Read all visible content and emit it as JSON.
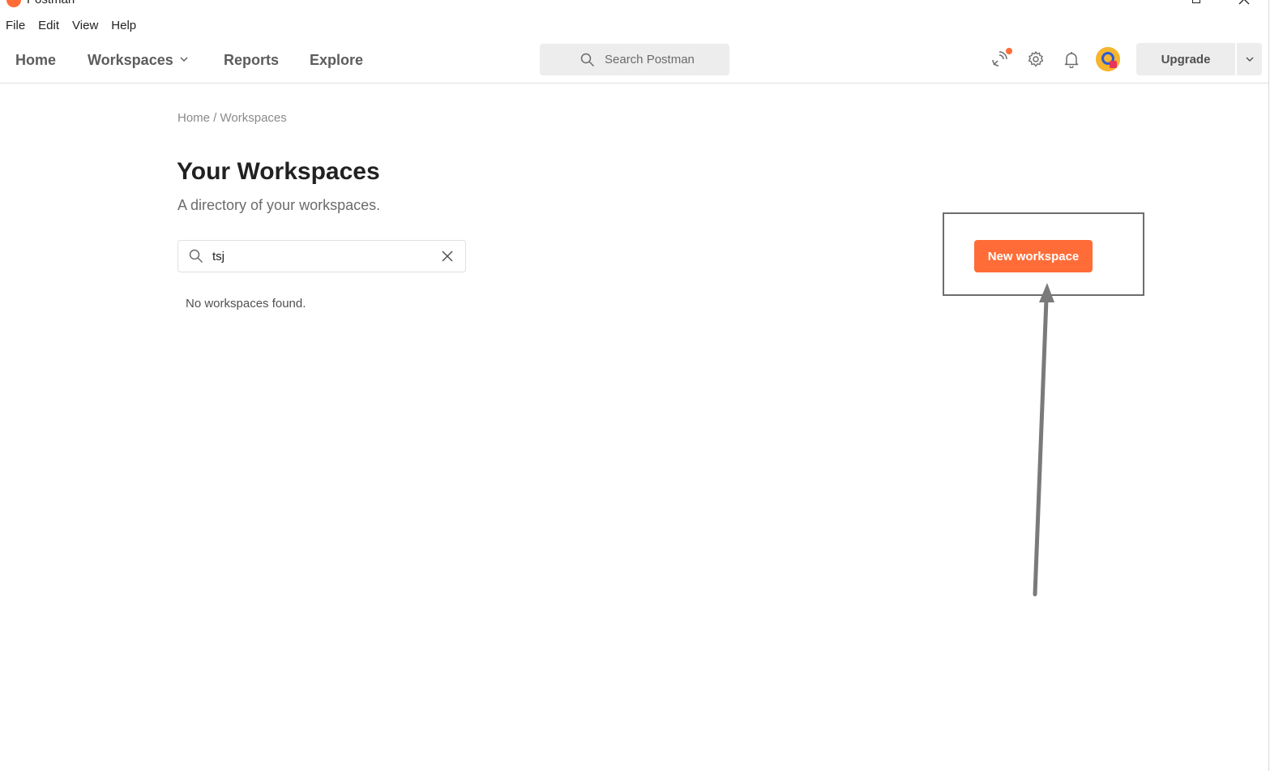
{
  "window": {
    "title": "Postman"
  },
  "menubar": {
    "items": [
      "File",
      "Edit",
      "View",
      "Help"
    ]
  },
  "header": {
    "nav": {
      "home": "Home",
      "workspaces": "Workspaces",
      "reports": "Reports",
      "explore": "Explore"
    },
    "search_placeholder": "Search Postman",
    "icons": [
      "satellite-icon",
      "gear-icon",
      "bell-icon",
      "avatar"
    ],
    "upgrade_label": "Upgrade"
  },
  "content": {
    "breadcrumb": "Home / Workspaces",
    "title": "Your Workspaces",
    "subtitle": "A directory of your workspaces.",
    "filter_value": "tsj",
    "empty_message": "No workspaces found.",
    "new_workspace_label": "New workspace"
  },
  "colors": {
    "accent": "#ff6c37",
    "annotation": "#6d6d6d"
  }
}
